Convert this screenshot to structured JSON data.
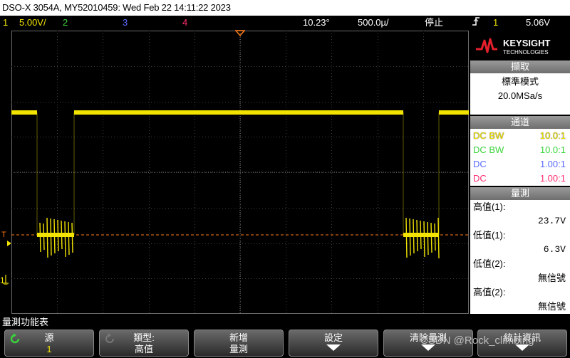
{
  "title_bar": "DSO-X 3054A, MY52010459: Wed Feb 22 14:11:22 2023",
  "status": {
    "ch1_num": "1",
    "ch1_scale": "5.00V/",
    "ch2_num": "2",
    "ch3_num": "3",
    "ch4_num": "4",
    "time_offset": "10.23°",
    "timebase": "500.0µ/",
    "run_state": "停止",
    "trig_icon": "trigger-edge-icon",
    "trig_ch": "1",
    "trig_level": "5.06V"
  },
  "colors": {
    "ch1": "#f2e400",
    "ch2": "#39d43b",
    "ch3": "#5a6bff",
    "ch4": "#ff2e6e",
    "trigger": "#ff7a1a"
  },
  "logo": {
    "brand": "KEYSIGHT",
    "sub": "TECHNOLOGIES"
  },
  "acquisition": {
    "header": "擷取",
    "mode": "標準模式",
    "rate": "20.0MSa/s"
  },
  "channels": {
    "header": "通道",
    "rows": [
      {
        "coupling": "DC BW",
        "probe": "10.0:1"
      },
      {
        "coupling": "DC BW",
        "probe": "10.0:1"
      },
      {
        "coupling": "DC",
        "probe": "1.00:1"
      },
      {
        "coupling": "DC",
        "probe": "1.00:1"
      }
    ]
  },
  "measurements": {
    "header": "量測",
    "items": [
      {
        "label": "高值(1):",
        "value": "23.7V"
      },
      {
        "label": "低值(1):",
        "value": "6.3V"
      },
      {
        "label": "低值(2):",
        "value": "無信號"
      },
      {
        "label": "高值(2):",
        "value": "無信號"
      }
    ]
  },
  "menu_title": "量測功能表",
  "softkeys": [
    {
      "title": "源",
      "value": "1"
    },
    {
      "title": "類型:",
      "value": "高值"
    },
    {
      "title": "新增",
      "value": "量測"
    },
    {
      "title": "設定",
      "value": ""
    },
    {
      "title": "清除量測",
      "value": ""
    },
    {
      "title": "統計資訊",
      "value": ""
    }
  ],
  "watermark": "CSDN @Rock_climbing"
}
